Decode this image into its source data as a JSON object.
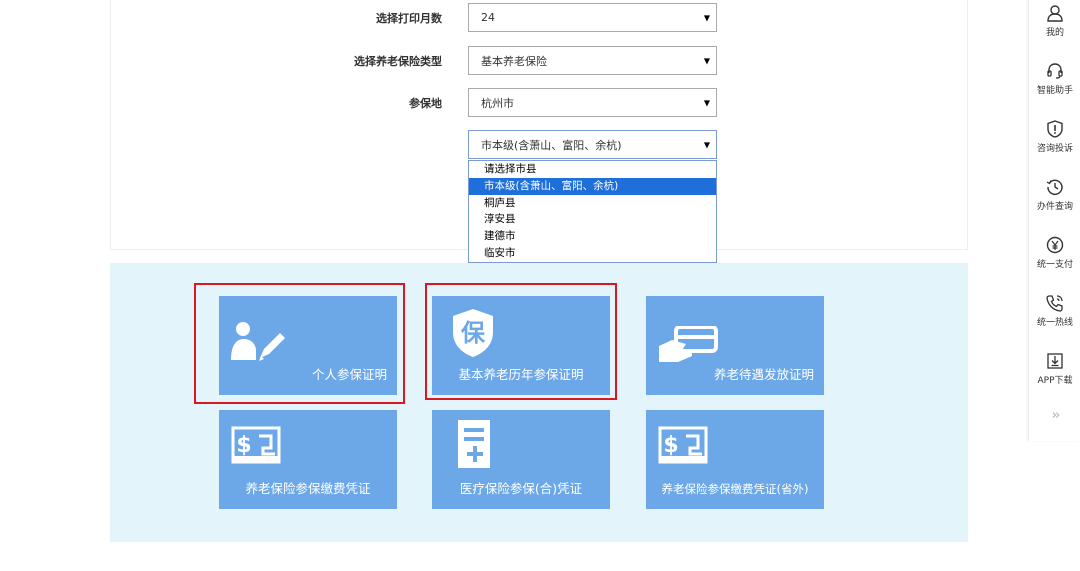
{
  "form": {
    "rows": [
      {
        "label": "选择打印月数",
        "value": "24"
      },
      {
        "label": "选择养老保险类型",
        "value": "基本养老保险"
      },
      {
        "label": "参保地",
        "value": "杭州市"
      }
    ],
    "district_select": {
      "value": "市本级(含萧山、富阳、余杭)"
    },
    "district_options": [
      {
        "label": "请选择市县",
        "selected": false
      },
      {
        "label": "市本级(含萧山、富阳、余杭)",
        "selected": true
      },
      {
        "label": "桐庐县",
        "selected": false
      },
      {
        "label": "淳安县",
        "selected": false
      },
      {
        "label": "建德市",
        "selected": false
      },
      {
        "label": "临安市",
        "selected": false
      }
    ]
  },
  "tiles": [
    {
      "label": "个人参保证明",
      "icon": "person-edit-icon",
      "highlighted": true
    },
    {
      "label": "基本养老历年参保证明",
      "icon": "bao-shield-icon",
      "highlighted": true
    },
    {
      "label": "养老待遇发放证明",
      "icon": "hand-card-icon",
      "highlighted": false
    },
    {
      "label": "养老保险参保缴费凭证",
      "icon": "money-bill-icon",
      "highlighted": false
    },
    {
      "label": "医疗保险参保(合)凭证",
      "icon": "document-plus-icon",
      "highlighted": false
    },
    {
      "label": "养老保险参保缴费凭证(省外)",
      "icon": "money-bill-icon",
      "highlighted": false
    }
  ],
  "sidebar": {
    "items": [
      {
        "label": "我的",
        "icon": "user-icon"
      },
      {
        "label": "智能助手",
        "icon": "headset-icon"
      },
      {
        "label": "咨询投诉",
        "icon": "alert-shield-icon"
      },
      {
        "label": "办件查询",
        "icon": "history-icon"
      },
      {
        "label": "统一支付",
        "icon": "yen-icon"
      },
      {
        "label": "统一热线",
        "icon": "phone-icon"
      },
      {
        "label": "APP下载",
        "icon": "download-icon"
      }
    ],
    "more": "››"
  },
  "colors": {
    "tile_blue": "#6ca8e8",
    "panel_bg": "#e4f4fb",
    "highlight_red": "#d9191f",
    "option_selected": "#1e6fd9"
  }
}
